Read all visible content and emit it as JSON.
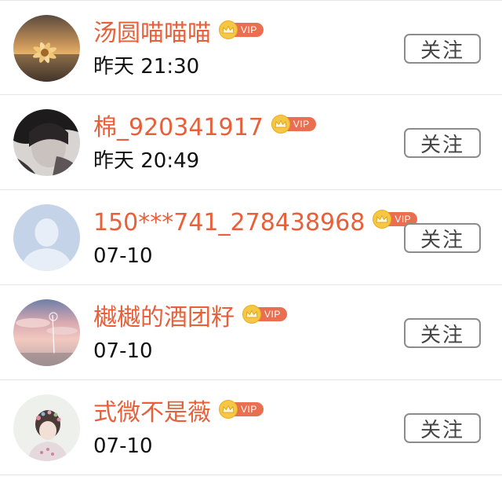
{
  "users": [
    {
      "name": "汤圆喵喵喵",
      "time": "昨天 21:30",
      "vip_label": "VIP",
      "follow_label": "关注",
      "avatar": "sunset-flower-avatar"
    },
    {
      "name": "棉_920341917",
      "time": "昨天 20:49",
      "vip_label": "VIP",
      "follow_label": "关注",
      "avatar": "dark-portrait-avatar"
    },
    {
      "name": "150***741_278438968",
      "time": "07-10",
      "vip_label": "VIP",
      "follow_label": "关注",
      "avatar": "default-person-avatar"
    },
    {
      "name": "樾樾的酒团籽",
      "time": "07-10",
      "vip_label": "VIP",
      "follow_label": "关注",
      "avatar": "pink-sky-avatar"
    },
    {
      "name": "式微不是薇",
      "time": "07-10",
      "vip_label": "VIP",
      "follow_label": "关注",
      "avatar": "girl-flower-crown-avatar"
    }
  ],
  "colors": {
    "name": "#e8603a",
    "vip_badge": "#ea6f51",
    "crown": "#f6c744",
    "button_border": "#8c8c8c"
  }
}
